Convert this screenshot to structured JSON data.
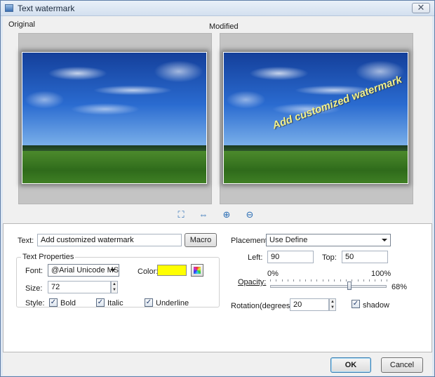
{
  "window": {
    "title": "Text watermark",
    "close_glyph": "✕"
  },
  "preview": {
    "original_label": "Original",
    "modified_label": "Modified",
    "watermark_text": "Add customized watermark",
    "toolbar": [
      {
        "name": "fit-window-icon",
        "glyph": "⛶"
      },
      {
        "name": "actual-size-icon",
        "glyph": "⇔"
      },
      {
        "name": "zoom-in-icon",
        "glyph": "⊕"
      },
      {
        "name": "zoom-out-icon",
        "glyph": "⊖"
      }
    ]
  },
  "text": {
    "label": "Text:",
    "value": "Add customized watermark",
    "macro_label": "Macro"
  },
  "text_properties": {
    "group_title": "Text Properties",
    "font_label": "Font:",
    "font_value": "@Arial Unicode MS",
    "size_label": "Size:",
    "size_value": "72",
    "color_label": "Color:",
    "color_value": "#ffff00",
    "style_label": "Style:",
    "bold_label": "Bold",
    "italic_label": "Italic",
    "underline_label": "Underline",
    "bold_checked": true,
    "italic_checked": true,
    "underline_checked": true,
    "check_glyph": "✓"
  },
  "placement": {
    "label": "Placement:",
    "value": "Use Define",
    "left_label": "Left:",
    "left_value": "90",
    "top_label": "Top:",
    "top_value": "50"
  },
  "opacity": {
    "label": "Opacity:",
    "min_label": "0%",
    "max_label": "100%",
    "value_label": "68%",
    "value": 68
  },
  "rotation": {
    "label": "Rotation(degrees):",
    "value": "20",
    "shadow_label": "shadow",
    "shadow_checked": true
  },
  "footer": {
    "ok_label": "OK",
    "cancel_label": "Cancel"
  },
  "spin_up": "▲",
  "spin_down": "▼"
}
